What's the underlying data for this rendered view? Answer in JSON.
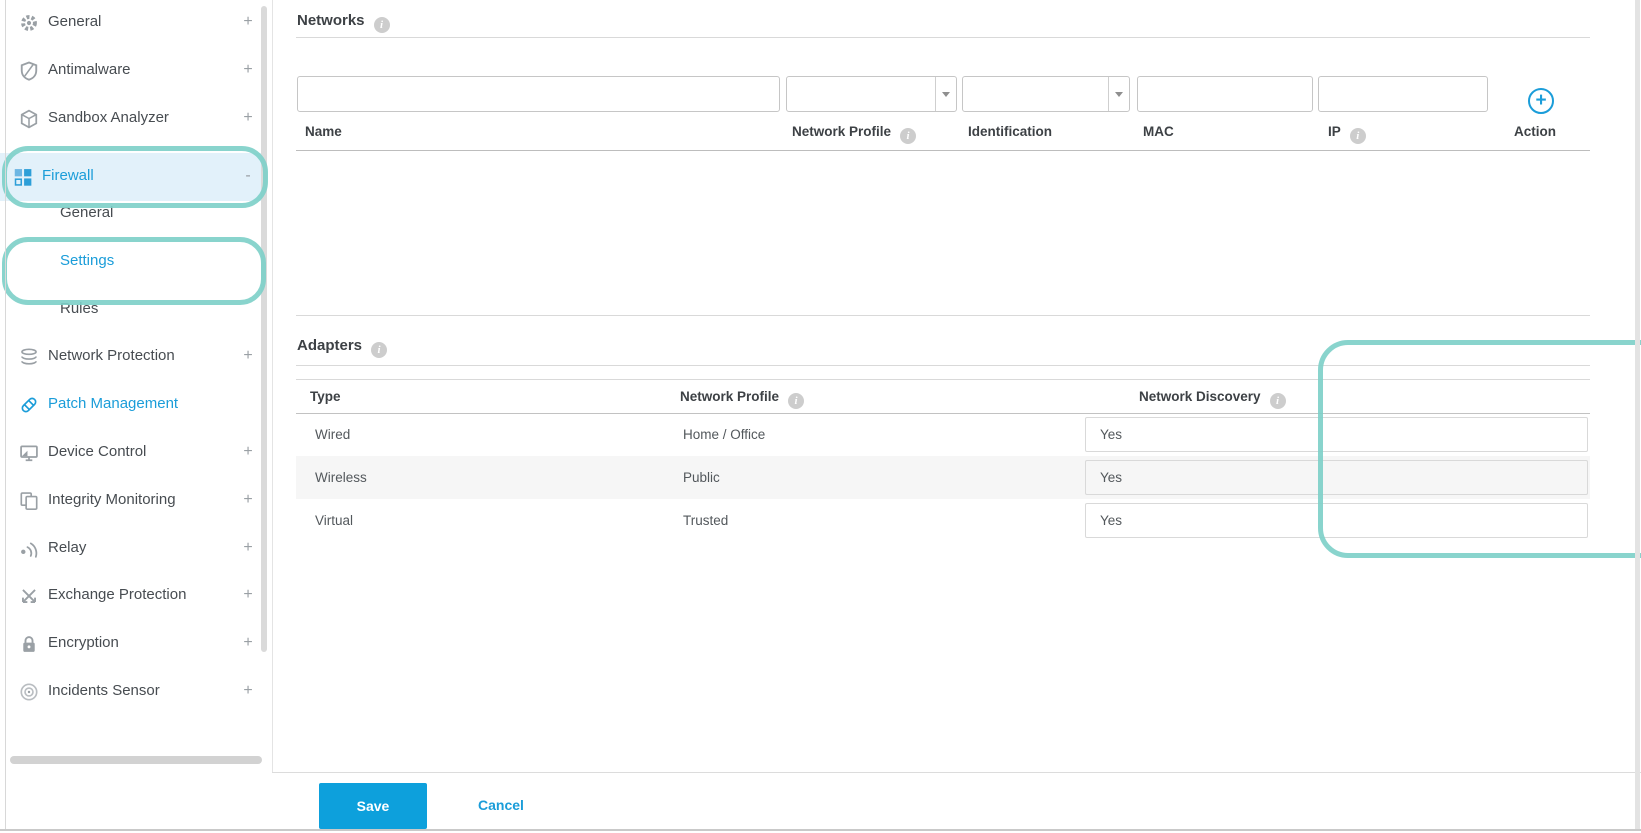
{
  "colors": {
    "accent": "#1b9dd9",
    "annotation": "#7ccfc8",
    "save_background": "#0da0dc",
    "active_item_background": "#e2f1fa"
  },
  "icons": {
    "info": "i",
    "add": "+"
  },
  "sidebar": {
    "items": [
      {
        "label": "General",
        "icon": "gear-icon",
        "expander": "+"
      },
      {
        "label": "Antimalware",
        "icon": "shield-icon",
        "expander": "+"
      },
      {
        "label": "Sandbox Analyzer",
        "icon": "cube-icon",
        "expander": "+"
      },
      {
        "label": "Firewall",
        "icon": "firewall-icon",
        "expander": "-",
        "active": true,
        "children": [
          {
            "label": "General"
          },
          {
            "label": "Settings",
            "active": true
          },
          {
            "label": "Rules"
          }
        ]
      },
      {
        "label": "Network Protection",
        "icon": "layers-icon",
        "expander": "+"
      },
      {
        "label": "Patch Management",
        "icon": "patch-icon",
        "expander": ""
      },
      {
        "label": "Device Control",
        "icon": "monitor-icon",
        "expander": "+"
      },
      {
        "label": "Integrity Monitoring",
        "icon": "documents-icon",
        "expander": "+"
      },
      {
        "label": "Relay",
        "icon": "signal-icon",
        "expander": "+"
      },
      {
        "label": "Exchange Protection",
        "icon": "exchange-icon",
        "expander": "+"
      },
      {
        "label": "Encryption",
        "icon": "lock-icon",
        "expander": "+"
      },
      {
        "label": "Incidents Sensor",
        "icon": "sensor-icon",
        "expander": "+"
      }
    ]
  },
  "networks": {
    "title": "Networks",
    "columns": [
      {
        "label": "Name"
      },
      {
        "label": "Network Profile",
        "info": true
      },
      {
        "label": "Identification"
      },
      {
        "label": "MAC"
      },
      {
        "label": "IP",
        "info": true
      },
      {
        "label": "Action"
      }
    ],
    "filters": {
      "name_value": "",
      "profile_value": "",
      "identification_value": "",
      "mac_value": "",
      "ip_value": ""
    },
    "rows": []
  },
  "adapters": {
    "title": "Adapters",
    "columns": [
      {
        "label": "Type"
      },
      {
        "label": "Network Profile",
        "info": true
      },
      {
        "label": "Network Discovery",
        "info": true
      }
    ],
    "rows": [
      {
        "type": "Wired",
        "profile": "Home / Office",
        "discovery": "Yes"
      },
      {
        "type": "Wireless",
        "profile": "Public",
        "discovery": "Yes"
      },
      {
        "type": "Virtual",
        "profile": "Trusted",
        "discovery": "Yes"
      }
    ]
  },
  "footer": {
    "save_label": "Save",
    "cancel_label": "Cancel"
  }
}
